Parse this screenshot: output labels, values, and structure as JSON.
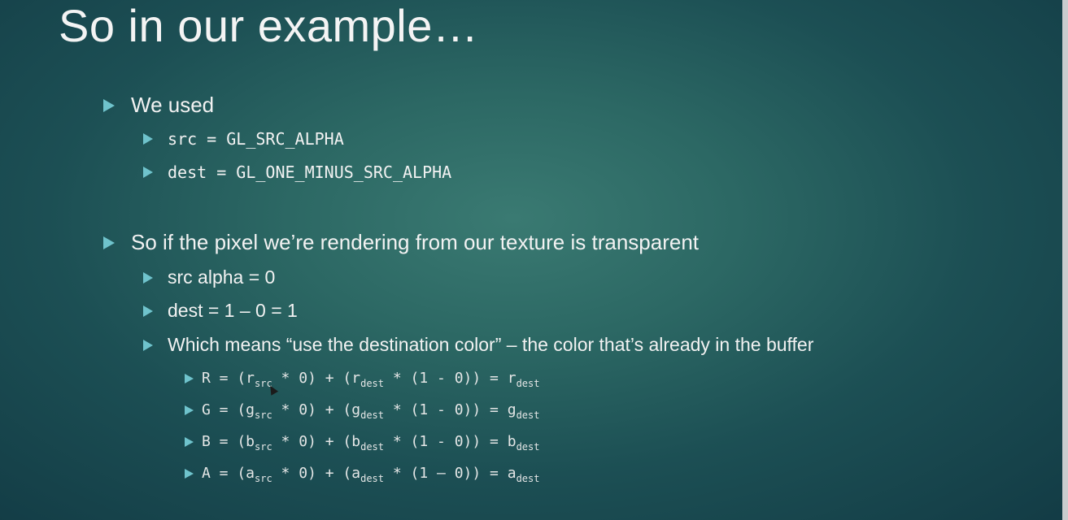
{
  "slide": {
    "title": "So in our example…",
    "bullets": [
      {
        "text": "We used",
        "sub": [
          "src = GL_SRC_ALPHA",
          "dest = GL_ONE_MINUS_SRC_ALPHA"
        ]
      },
      {
        "text": "So if the pixel we’re rendering from our texture is transparent",
        "sub": [
          "src alpha = 0",
          "dest = 1 – 0 = 1",
          "Which means “use the destination color” – the color that’s already in the buffer"
        ]
      }
    ],
    "equations": [
      {
        "lhs": "R = (r",
        "s1": "src",
        "mid": " * 0) + (r",
        "s2": "dest",
        "rhs": " * (1 - 0)) = r",
        "s3": "dest"
      },
      {
        "lhs": "G = (g",
        "s1": "src",
        "mid": " * 0) + (g",
        "s2": "dest",
        "rhs": " * (1 - 0)) = g",
        "s3": "dest"
      },
      {
        "lhs": "B = (b",
        "s1": "src",
        "mid": " * 0) + (b",
        "s2": "dest",
        "rhs": " * (1 - 0)) = b",
        "s3": "dest"
      },
      {
        "lhs": "A = (a",
        "s1": "src",
        "mid": " * 0) + (a",
        "s2": "dest",
        "rhs": " * (1 – 0)) = a",
        "s3": "dest"
      }
    ]
  },
  "colors": {
    "bullet_accent": "#6fc3cc",
    "background_center": "#3a7a72",
    "background_edge": "#123a44"
  },
  "icons": {
    "bullet": "triangle-bullet-icon",
    "cursor": "mouse-cursor-icon"
  }
}
